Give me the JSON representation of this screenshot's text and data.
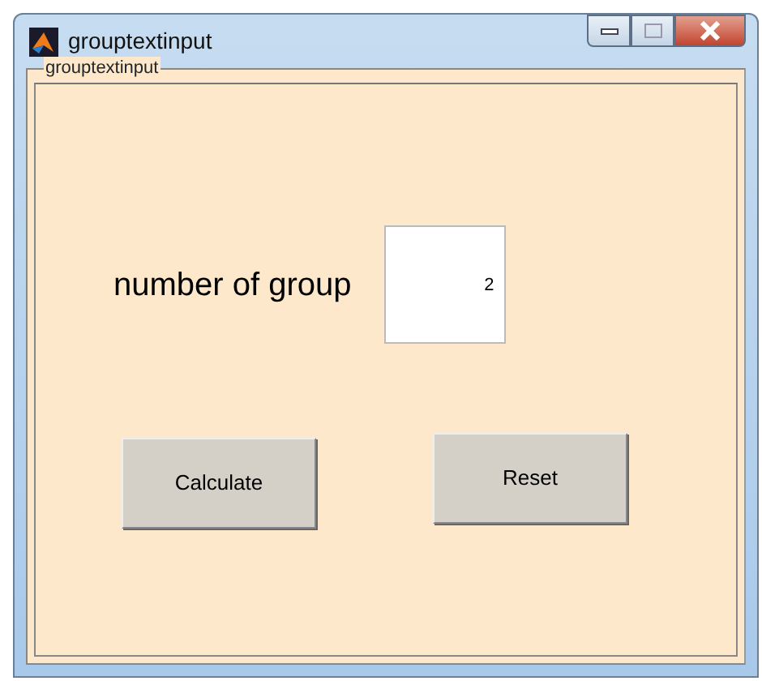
{
  "window": {
    "title": "grouptextinput"
  },
  "panel": {
    "title": "grouptextinput"
  },
  "label": "number of group",
  "field": {
    "value": "2"
  },
  "buttons": [
    {
      "label": "Calculate"
    },
    {
      "label": "Reset"
    }
  ]
}
